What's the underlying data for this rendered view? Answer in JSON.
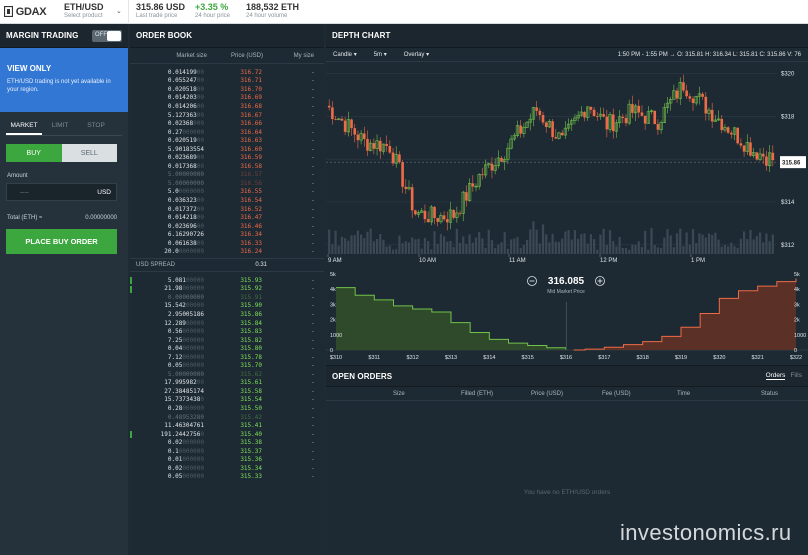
{
  "topbar": {
    "logo": "GDAX",
    "product": {
      "value": "ETH/USD",
      "label": "Select product"
    },
    "last_price": {
      "value": "315.86 USD",
      "label": "Last trade price"
    },
    "change": {
      "value": "+3.35 %",
      "label": "24 hour price"
    },
    "volume": {
      "value": "188,532 ETH",
      "label": "24 hour volume"
    }
  },
  "sidebar": {
    "title": "MARGIN TRADING",
    "toggle": "OFF",
    "notice_title": "VIEW ONLY",
    "notice_text": "ETH/USD trading is not yet available in your region.",
    "order_tabs": [
      {
        "label": "MARKET",
        "active": true
      },
      {
        "label": "LIMIT",
        "active": false
      },
      {
        "label": "STOP",
        "active": false
      }
    ],
    "buy_label": "BUY",
    "sell_label": "SELL",
    "amount_label": "Amount",
    "amount_placeholder": "----",
    "amount_unit": "USD",
    "total_label": "Total (ETH) ≈",
    "total_value": "0.00000000",
    "place_button": "PLACE BUY ORDER"
  },
  "orderbook": {
    "title": "ORDER BOOK",
    "columns": [
      "Market size",
      "Price (USD)",
      "My size"
    ],
    "asks": [
      {
        "size": "0.014199",
        "pad": "00",
        "price": "316.72",
        "my": "-"
      },
      {
        "size": "0.055247",
        "pad": "00",
        "price": "316.71",
        "my": "-"
      },
      {
        "size": "0.020518",
        "pad": "00",
        "price": "316.70",
        "my": "-"
      },
      {
        "size": "0.014203",
        "pad": "00",
        "price": "316.69",
        "my": "-"
      },
      {
        "size": "0.014206",
        "pad": "00",
        "price": "316.68",
        "my": "-"
      },
      {
        "size": "5.127363",
        "pad": "00",
        "price": "316.67",
        "my": "-"
      },
      {
        "size": "0.02368",
        "pad": "000",
        "price": "316.66",
        "my": "-"
      },
      {
        "size": "0.27",
        "pad": "000000",
        "price": "316.64",
        "my": "-"
      },
      {
        "size": "0.020519",
        "pad": "00",
        "price": "316.63",
        "my": "-"
      },
      {
        "size": "5.90183554",
        "pad": "",
        "price": "316.60",
        "my": "-"
      },
      {
        "size": "0.023689",
        "pad": "00",
        "price": "316.59",
        "my": "-"
      },
      {
        "size": "0.017368",
        "pad": "00",
        "price": "316.58",
        "my": "-"
      },
      {
        "size": "5.00000000",
        "pad": "",
        "price": "316.57",
        "my": "-",
        "dim": true
      },
      {
        "size": "5.00000000",
        "pad": "",
        "price": "316.56",
        "my": "-",
        "dim": true
      },
      {
        "size": "5.0",
        "pad": "0000000",
        "price": "316.55",
        "my": "-"
      },
      {
        "size": "0.036323",
        "pad": "00",
        "price": "316.54",
        "my": "-"
      },
      {
        "size": "0.017372",
        "pad": "00",
        "price": "316.52",
        "my": "-"
      },
      {
        "size": "0.014218",
        "pad": "00",
        "price": "316.47",
        "my": "-"
      },
      {
        "size": "0.023696",
        "pad": "00",
        "price": "316.46",
        "my": "-"
      },
      {
        "size": "6.16290726",
        "pad": "",
        "price": "316.34",
        "my": "-"
      },
      {
        "size": "0.061638",
        "pad": "00",
        "price": "316.33",
        "my": "-"
      },
      {
        "size": "20.0",
        "pad": "0000000",
        "price": "316.24",
        "my": "-"
      }
    ],
    "spread_label": "USD SPREAD",
    "spread_value": "0.31",
    "bids": [
      {
        "size": "5.081",
        "pad": "00000",
        "price": "315.93",
        "my": "-",
        "bar": true
      },
      {
        "size": "21.98",
        "pad": "000000",
        "price": "315.92",
        "my": "-",
        "bar": true
      },
      {
        "size": "0.00000000",
        "pad": "",
        "price": "315.91",
        "my": "-",
        "dim": true
      },
      {
        "size": "15.542",
        "pad": "00000",
        "price": "315.90",
        "my": "-"
      },
      {
        "size": "2.95005186",
        "pad": "",
        "price": "315.86",
        "my": "-"
      },
      {
        "size": "12.289",
        "pad": "00000",
        "price": "315.84",
        "my": "-"
      },
      {
        "size": "0.56",
        "pad": "000000",
        "price": "315.83",
        "my": "-"
      },
      {
        "size": "7.25",
        "pad": "000000",
        "price": "315.82",
        "my": "-"
      },
      {
        "size": "0.04",
        "pad": "000000",
        "price": "315.80",
        "my": "-"
      },
      {
        "size": "7.12",
        "pad": "000000",
        "price": "315.78",
        "my": "-"
      },
      {
        "size": "0.05",
        "pad": "000000",
        "price": "315.70",
        "my": "-"
      },
      {
        "size": "5.00000000",
        "pad": "",
        "price": "315.62",
        "my": "-",
        "dim": true
      },
      {
        "size": "17.995982",
        "pad": "00",
        "price": "315.61",
        "my": "-"
      },
      {
        "size": "27.38485174",
        "pad": "",
        "price": "315.58",
        "my": "-"
      },
      {
        "size": "15.7373438",
        "pad": "0",
        "price": "315.54",
        "my": "-"
      },
      {
        "size": "0.28",
        "pad": "000000",
        "price": "315.50",
        "my": "-"
      },
      {
        "size": "0.48953280",
        "pad": "",
        "price": "315.42",
        "my": "-",
        "dim": true
      },
      {
        "size": "11.46304761",
        "pad": "",
        "price": "315.41",
        "my": "-"
      },
      {
        "size": "191.2442756",
        "pad": "0",
        "price": "315.40",
        "my": "-",
        "bar": true
      },
      {
        "size": "0.02",
        "pad": "000000",
        "price": "315.38",
        "my": "-"
      },
      {
        "size": "0.1",
        "pad": "0000000",
        "price": "315.37",
        "my": "-"
      },
      {
        "size": "0.01",
        "pad": "000000",
        "price": "315.36",
        "my": "-"
      },
      {
        "size": "0.02",
        "pad": "000000",
        "price": "315.34",
        "my": "-"
      },
      {
        "size": "0.05",
        "pad": "000000",
        "price": "315.33",
        "my": "-"
      }
    ]
  },
  "depth_chart": {
    "title": "DEPTH CHART",
    "tools": [
      "Candle",
      "5m",
      "Overlay"
    ],
    "ohlc_text": "1:50 PM - 1:55 PM →  O: 315.81  H: 316.34  L: 315.81  C: 315.86  V: 76",
    "price_axis": [
      "$320",
      "$318",
      "$316",
      "$314",
      "$312"
    ],
    "current_price_tag": "315.86",
    "time_axis": [
      "9 AM",
      "10 AM",
      "11 AM",
      "12 PM",
      "1 PM"
    ],
    "mid_price": "316.085",
    "mid_label": "Mid Market Price",
    "depth_y_axis": [
      "5k",
      "4k",
      "3k",
      "2k",
      "1000",
      "0"
    ],
    "depth_x_axis": [
      "$310",
      "$311",
      "$312",
      "$313",
      "$314",
      "$315",
      "$316",
      "$317",
      "$318",
      "$319",
      "$320",
      "$321",
      "$322"
    ],
    "colors": {
      "up": "#72c14b",
      "down": "#ee6b47",
      "bid_fill": "#2e4a2a",
      "ask_fill": "#5a3027"
    }
  },
  "chart_data": {
    "type": "line",
    "title": "",
    "xlabel": "",
    "ylabel": "",
    "x_units": "USD",
    "series": [
      {
        "x": [
          310,
          310.5,
          311,
          311.5,
          312,
          312.5,
          313,
          313.5,
          314,
          314.5,
          315,
          315.5,
          316
        ],
        "values": [
          4100,
          3600,
          3300,
          2900,
          2700,
          2500,
          1800,
          1150,
          700,
          450,
          300,
          150,
          0
        ]
      },
      {
        "x": [
          316.2,
          316.5,
          317,
          317.5,
          318,
          318.5,
          319,
          319.5,
          320,
          320.5,
          321,
          321.5,
          322
        ],
        "values": [
          0,
          60,
          180,
          350,
          550,
          900,
          1500,
          2400,
          3400,
          3900,
          4200,
          4500,
          4700
        ]
      }
    ],
    "ylim": [
      0,
      5000
    ],
    "xlim": [
      310,
      322
    ]
  },
  "open_orders": {
    "title": "OPEN ORDERS",
    "tabs": [
      {
        "label": "Orders",
        "active": true
      },
      {
        "label": "Fills",
        "active": false
      }
    ],
    "columns": [
      "Size",
      "Filled (ETH)",
      "Price (USD)",
      "Fee (USD)",
      "Time",
      "Status"
    ],
    "empty_text": "You have no ETH/USD orders"
  },
  "watermark": "investonomics.ru"
}
